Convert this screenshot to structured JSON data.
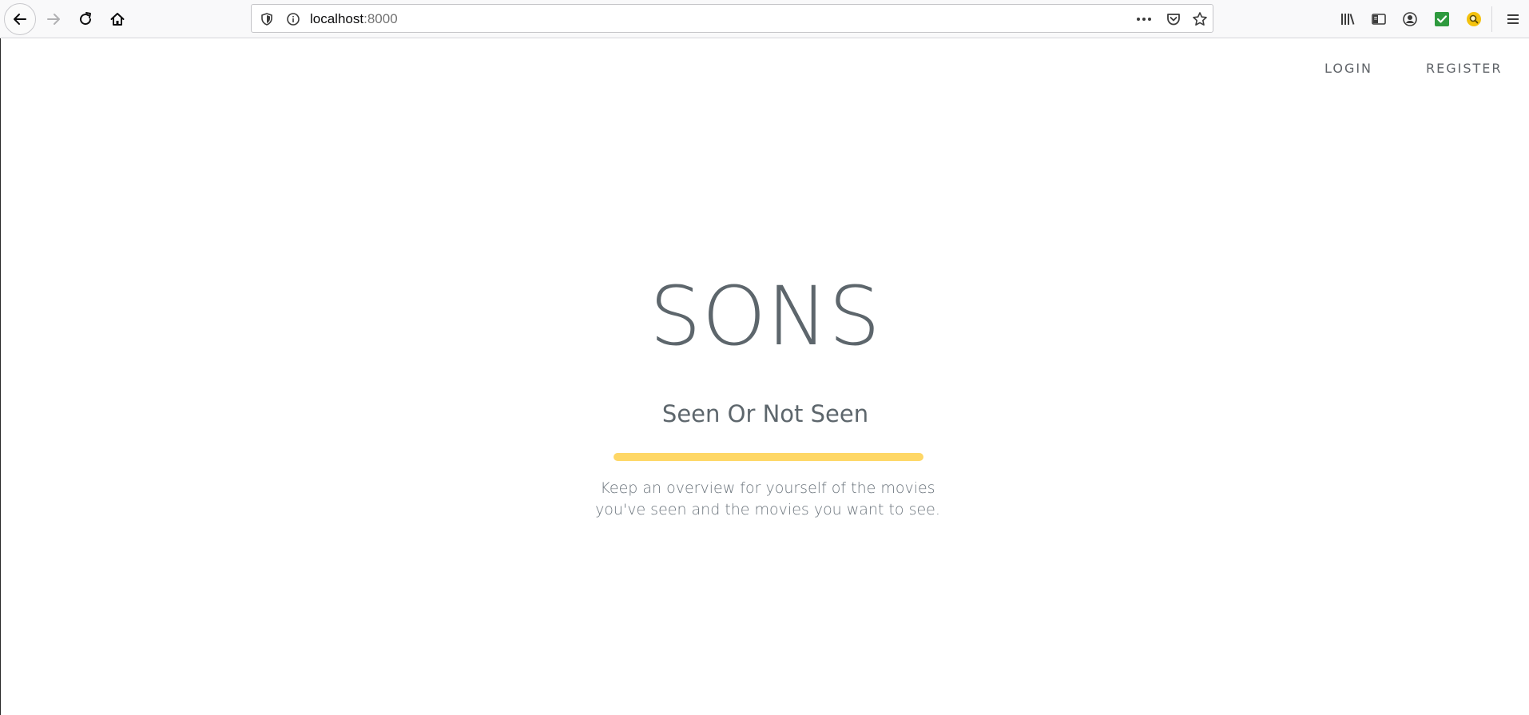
{
  "browser": {
    "url_host": "localhost",
    "url_port": ":8000",
    "icons": {
      "back": "back-arrow-icon",
      "forward": "forward-arrow-icon",
      "reload": "reload-icon",
      "home": "home-icon",
      "tracking": "shield-icon",
      "site_info": "info-icon",
      "page_actions": "more-dots-icon",
      "pocket": "pocket-icon",
      "bookmark": "star-icon",
      "library": "library-icon",
      "sidebar": "sidebar-icon",
      "account": "account-icon",
      "extension_check": "green-check-extension-icon",
      "extension_search": "yellow-search-extension-icon",
      "menu": "hamburger-menu-icon"
    }
  },
  "nav": {
    "login": "LOGIN",
    "register": "REGISTER"
  },
  "hero": {
    "title": "SONS",
    "subtitle": "Seen Or Not Seen",
    "description": "Keep an overview for yourself of the movies you've seen and the movies you want to see."
  },
  "colors": {
    "accent": "#fed766",
    "text": "#5d666c",
    "muted": "#6c757d"
  }
}
